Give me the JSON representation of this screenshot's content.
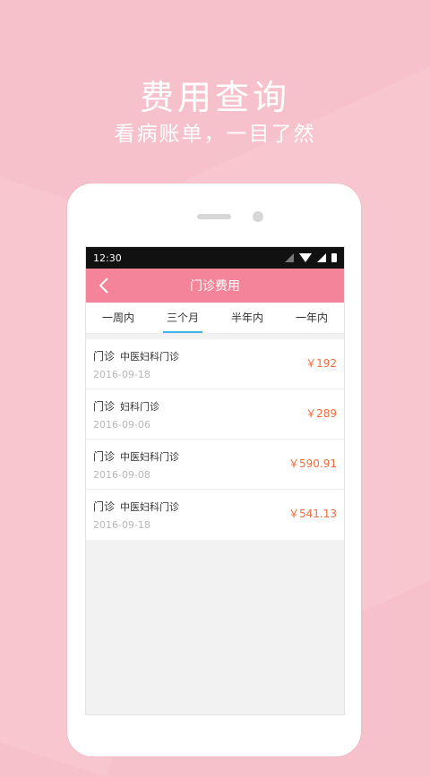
{
  "promo": {
    "title": "费用查询",
    "subtitle": "看病账单，一目了然"
  },
  "status": {
    "time": "12:30"
  },
  "appbar": {
    "title": "门诊费用"
  },
  "tabs": [
    {
      "label": "一周内",
      "active": false
    },
    {
      "label": "三个月",
      "active": true
    },
    {
      "label": "半年内",
      "active": false
    },
    {
      "label": "一年内",
      "active": false
    }
  ],
  "records": [
    {
      "type": "门诊",
      "dept": "中医妇科门诊",
      "date": "2016-09-18",
      "amount": "￥192"
    },
    {
      "type": "门诊",
      "dept": "妇科门诊",
      "date": "2016-09-06",
      "amount": "￥289"
    },
    {
      "type": "门诊",
      "dept": "中医妇科门诊",
      "date": "2016-09-08",
      "amount": "￥590.91"
    },
    {
      "type": "门诊",
      "dept": "中医妇科门诊",
      "date": "2016-09-18",
      "amount": "￥541.13"
    }
  ],
  "colors": {
    "background": "#f7c1cb",
    "appbar": "#f48499",
    "tab_indicator": "#3eb4e9",
    "amount": "#f46a3a"
  }
}
